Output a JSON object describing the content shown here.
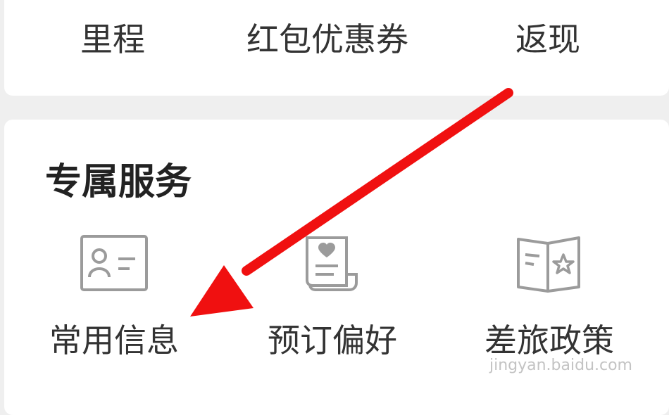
{
  "top_links": [
    {
      "label": "里程"
    },
    {
      "label": "红包优惠券"
    },
    {
      "label": "返现"
    }
  ],
  "section": {
    "title": "专属服务",
    "items": [
      {
        "label": "常用信息",
        "icon": "contact-card-icon"
      },
      {
        "label": "预订偏好",
        "icon": "heart-scroll-icon"
      },
      {
        "label": "差旅政策",
        "icon": "star-book-icon"
      }
    ]
  },
  "watermark": "jingyan.baidu.com",
  "colors": {
    "icon": "#9b9b9b",
    "arrow": "#f01010",
    "text": "#333333",
    "card": "#ffffff",
    "background": "#efefef"
  }
}
